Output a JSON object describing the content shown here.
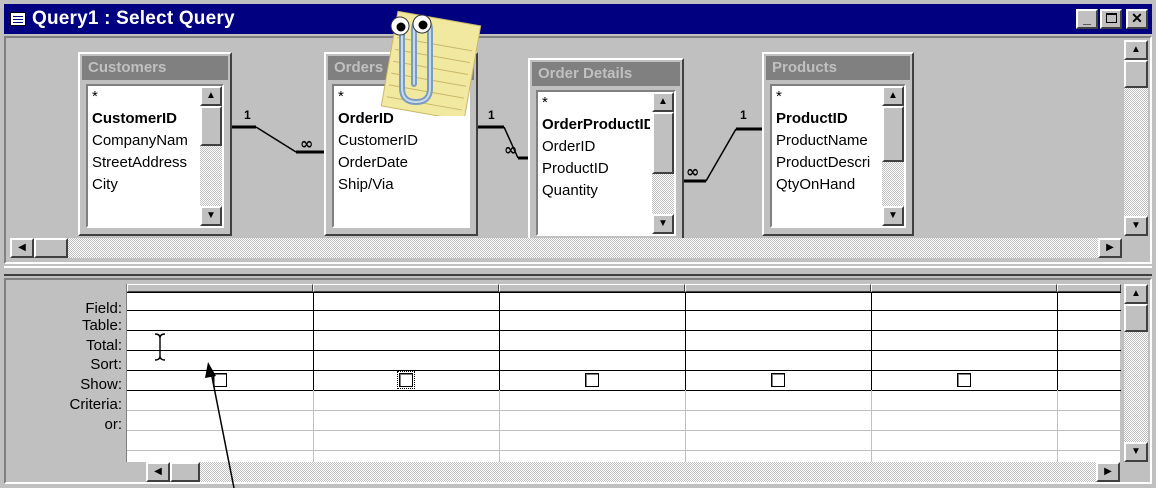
{
  "window": {
    "title": "Query1 : Select Query",
    "controls": [
      "minimize",
      "maximize",
      "close"
    ]
  },
  "tables": [
    {
      "title": "Customers",
      "fields": [
        {
          "name": "*",
          "pk": false
        },
        {
          "name": "CustomerID",
          "pk": true
        },
        {
          "name": "CompanyNam",
          "pk": false
        },
        {
          "name": "StreetAddress",
          "pk": false
        },
        {
          "name": "City",
          "pk": false
        }
      ]
    },
    {
      "title": "Orders",
      "fields": [
        {
          "name": "*",
          "pk": false
        },
        {
          "name": "OrderID",
          "pk": true
        },
        {
          "name": "CustomerID",
          "pk": false
        },
        {
          "name": "OrderDate",
          "pk": false
        },
        {
          "name": "Ship/Via",
          "pk": false
        }
      ]
    },
    {
      "title": "Order Details",
      "fields": [
        {
          "name": "*",
          "pk": false
        },
        {
          "name": "OrderProductID",
          "pk": true
        },
        {
          "name": "OrderID",
          "pk": false
        },
        {
          "name": "ProductID",
          "pk": false
        },
        {
          "name": "Quantity",
          "pk": false
        }
      ]
    },
    {
      "title": "Products",
      "fields": [
        {
          "name": "*",
          "pk": false
        },
        {
          "name": "ProductID",
          "pk": true
        },
        {
          "name": "ProductName",
          "pk": false
        },
        {
          "name": "ProductDescri",
          "pk": false
        },
        {
          "name": "QtyOnHand",
          "pk": false
        }
      ]
    }
  ],
  "relationships": [
    {
      "one_label": "1",
      "many_label": "∞"
    },
    {
      "one_label": "1",
      "many_label": "∞"
    },
    {
      "one_label": "1",
      "many_label": "∞"
    }
  ],
  "grid": {
    "row_labels": [
      "Field:",
      "Table:",
      "Total:",
      "Sort:",
      "Show:",
      "Criteria:",
      "or:"
    ],
    "columns": 6,
    "show_checkboxes": [
      false,
      false,
      false,
      false,
      false
    ]
  },
  "icons": {
    "title": "query-window-icon",
    "assistant": "office-assistant-paperclip-icon",
    "cursor": "text-ibeam-cursor-icon",
    "annotation": "annotation-arrow"
  },
  "colors": {
    "titlebar": "#000080",
    "face": "#c0c0c0",
    "table_title": "#808080"
  }
}
